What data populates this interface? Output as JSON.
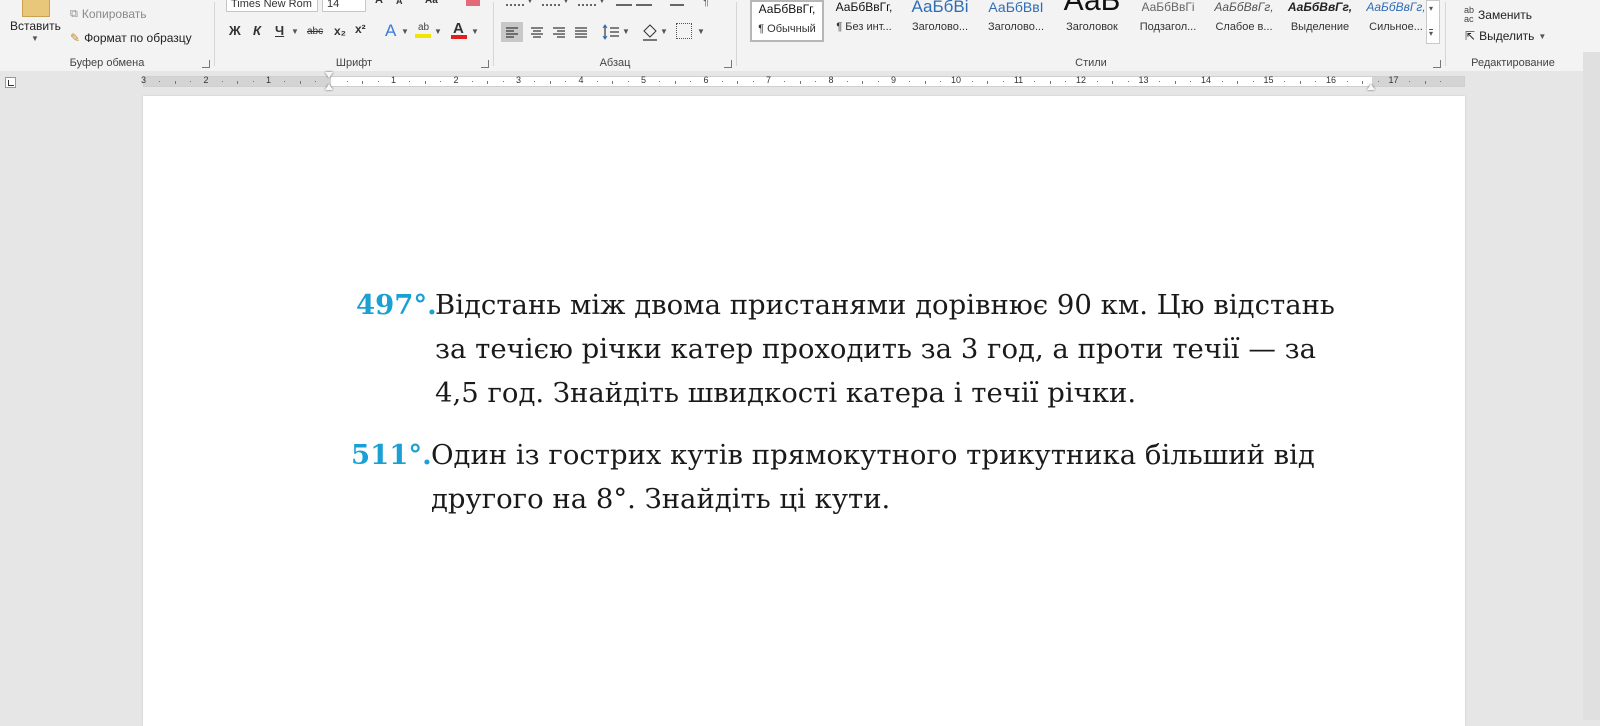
{
  "ribbon": {
    "clipboard": {
      "paste_label": "Вставить",
      "copy_label": "Копировать",
      "format_painter_label": "Формат по образцу",
      "group_label": "Буфер обмена"
    },
    "font": {
      "font_name": "Times New Rom",
      "font_size": "14",
      "bold": "Ж",
      "italic": "К",
      "underline": "Ч",
      "strikethrough": "abc",
      "subscript": "x₂",
      "superscript": "x²",
      "group_label": "Шрифт"
    },
    "paragraph": {
      "group_label": "Абзац"
    },
    "styles": {
      "items": [
        {
          "preview": "АаБбВвГг,",
          "name": "¶ Обычный"
        },
        {
          "preview": "АаБбВвГг,",
          "name": "¶ Без инт..."
        },
        {
          "preview": "АаБбВі",
          "name": "Заголово..."
        },
        {
          "preview": "АаБбВвІ",
          "name": "Заголово..."
        },
        {
          "preview": "АаБ",
          "name": "Заголовок"
        },
        {
          "preview": "АаБбВвГі",
          "name": "Подзагол..."
        },
        {
          "preview": "АаБбВвГг,",
          "name": "Слабое в..."
        },
        {
          "preview": "АаБбВвГг,",
          "name": "Выделение"
        },
        {
          "preview": "АаБбВвГг,",
          "name": "Сильное..."
        }
      ],
      "group_label": "Стили"
    },
    "editing": {
      "replace_label": "Заменить",
      "select_label": "Выделить",
      "group_label": "Редактирование"
    }
  },
  "ruler": {
    "labels": [
      "3",
      "2",
      "1",
      "1",
      "2",
      "3",
      "4",
      "5",
      "6",
      "7",
      "8",
      "9",
      "10",
      "11",
      "12",
      "13",
      "14",
      "15",
      "16",
      "17"
    ]
  },
  "document": {
    "problems": [
      {
        "number": "497°.",
        "lines": [
          "Відстань між двома пристанями дорівнює 90 км. Цю відстань",
          "за течією річки катер проходить за 3 год, а проти течії — за",
          "4,5 год. Знайдіть швидкості катера і течії річки."
        ]
      },
      {
        "number": "511°.",
        "lines": [
          "Один із гострих кутів прямокутного трикутника більший від",
          "другого на 8°. Знайдіть ці кути."
        ]
      }
    ]
  },
  "colors": {
    "problem_number": "#1aa0d2",
    "ribbon_bg": "#f3f3f3",
    "workspace_bg": "#e6e6e6"
  }
}
